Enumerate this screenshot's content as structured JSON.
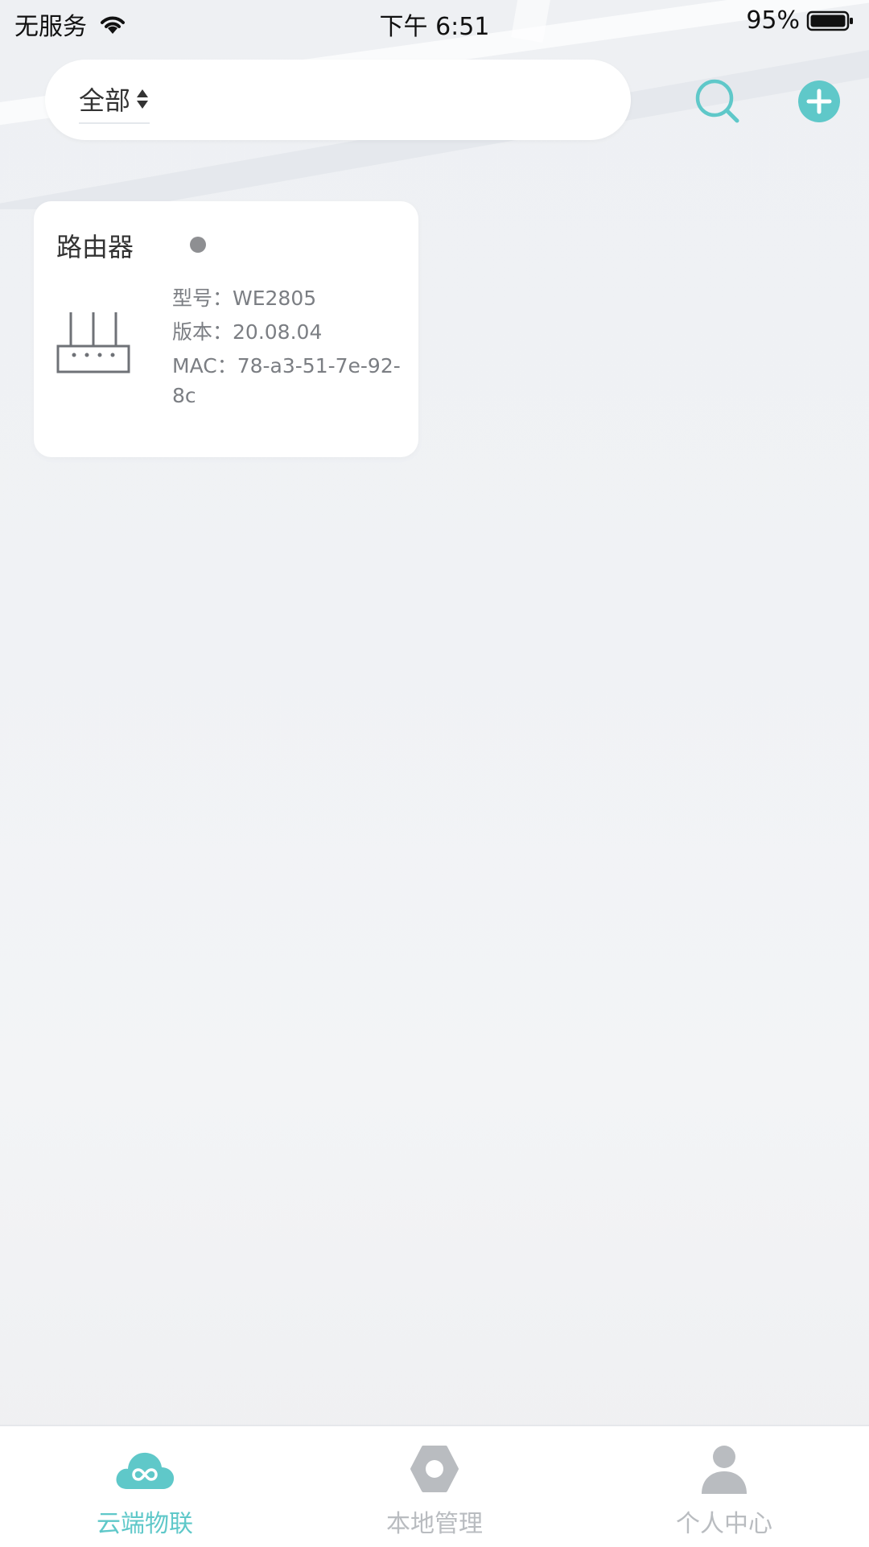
{
  "status_bar": {
    "carrier": "无服务",
    "time": "下午 6:51",
    "battery": "95%"
  },
  "header": {
    "filter_label": "全部",
    "icons": {
      "sort": "sort-updown-icon",
      "search": "search-icon",
      "add": "add-circle-icon"
    }
  },
  "device": {
    "name": "路由器",
    "status_color": "#8e8f92",
    "model_label": "型号：",
    "model": "WE2805",
    "version_label": "版本：",
    "version": "20.08.04",
    "mac_label": "MAC：",
    "mac": "78-a3-51-7e-92-8c",
    "icon": "router-icon"
  },
  "tabs": [
    {
      "label": "云端物联",
      "icon": "cloud-icon",
      "active": true
    },
    {
      "label": "本地管理",
      "icon": "hexagon-icon",
      "active": false
    },
    {
      "label": "个人中心",
      "icon": "person-icon",
      "active": false
    }
  ],
  "colors": {
    "accent": "#5fc8c9",
    "inactive": "#b9bcc0"
  }
}
